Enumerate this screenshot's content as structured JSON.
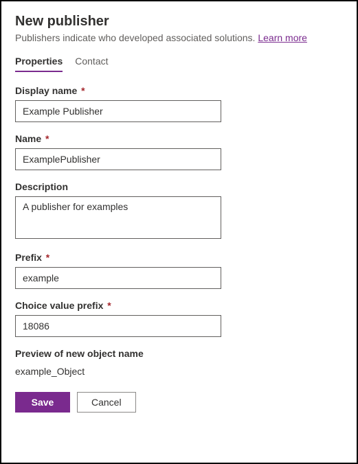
{
  "header": {
    "title": "New publisher",
    "subtitle": "Publishers indicate who developed associated solutions. ",
    "learn_more": "Learn more"
  },
  "tabs": {
    "properties": "Properties",
    "contact": "Contact"
  },
  "form": {
    "display_name": {
      "label": "Display name",
      "value": "Example Publisher"
    },
    "name": {
      "label": "Name",
      "value": "ExamplePublisher"
    },
    "description": {
      "label": "Description",
      "value": "A publisher for examples"
    },
    "prefix": {
      "label": "Prefix",
      "value": "example"
    },
    "choice_value_prefix": {
      "label": "Choice value prefix",
      "value": "18086"
    },
    "preview": {
      "label": "Preview of new object name",
      "value": "example_Object"
    }
  },
  "buttons": {
    "save": "Save",
    "cancel": "Cancel"
  }
}
